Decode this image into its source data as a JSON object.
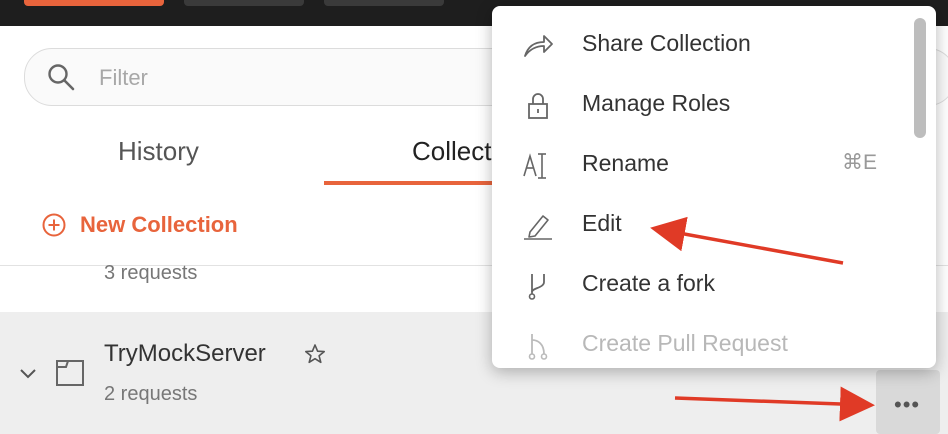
{
  "filter": {
    "placeholder": "Filter"
  },
  "tabs": {
    "history": "History",
    "collections": "Collect"
  },
  "new_collection": "New Collection",
  "collections": [
    {
      "requests": "3 requests"
    },
    {
      "name": "TryMockServer",
      "requests": "2 requests"
    }
  ],
  "context_menu": {
    "items": [
      {
        "label": "Share Collection",
        "icon": "share-icon"
      },
      {
        "label": "Manage Roles",
        "icon": "lock-icon"
      },
      {
        "label": "Rename",
        "icon": "rename-icon",
        "shortcut": "⌘E"
      },
      {
        "label": "Edit",
        "icon": "pencil-icon"
      },
      {
        "label": "Create a fork",
        "icon": "fork-icon"
      },
      {
        "label": "Create Pull Request",
        "icon": "pull-request-icon",
        "disabled": true
      }
    ]
  },
  "more_button": "•••",
  "colors": {
    "accent": "#e8643c",
    "annotation_arrow": "#e03a26",
    "topbar": "#1e1e1e"
  }
}
